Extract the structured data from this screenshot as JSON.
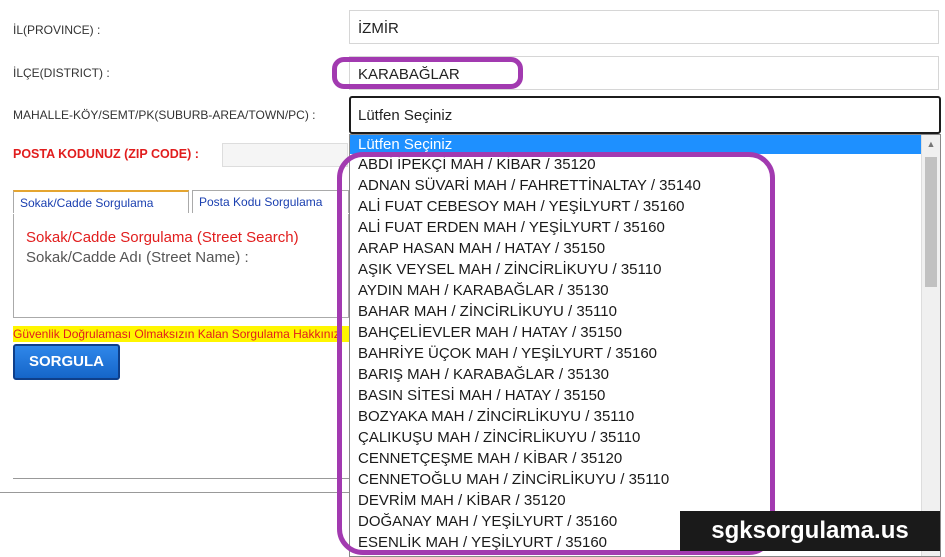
{
  "form": {
    "province_label": "İL(PROVINCE) :",
    "province_value": "İZMİR",
    "district_label": "İLÇE(DISTRICT) :",
    "district_value": "KARABAĞLAR",
    "suburb_label": "MAHALLE-KÖY/SEMT/PK(SUBURB-AREA/TOWN/PC) :",
    "suburb_selected": "Lütfen Seçiniz",
    "zip_label": "POSTA KODUNUZ (ZIP CODE) :"
  },
  "tabs": [
    {
      "label": "Sokak/Cadde Sorgulama"
    },
    {
      "label": "Posta Kodu Sorgulama"
    }
  ],
  "panel": {
    "title": "Sokak/Cadde Sorgulama (Street Search)",
    "street_label": "Sokak/Cadde Adı (Street Name) :"
  },
  "warning": "Güvenlik Doğrulaması Olmaksızın Kalan Sorgulama Hakkınız",
  "button": {
    "label": "SORGULA"
  },
  "dropdown": {
    "options": [
      "Lütfen Seçiniz",
      "ABDİ İPEKÇİ MAH / KİBAR / 35120",
      "ADNAN SÜVARİ MAH / FAHRETTİNALTAY / 35140",
      "ALİ FUAT CEBESOY MAH / YEŞİLYURT / 35160",
      "ALİ FUAT ERDEN MAH / YEŞİLYURT / 35160",
      "ARAP HASAN MAH / HATAY / 35150",
      "AŞIK VEYSEL MAH / ZİNCİRLİKUYU / 35110",
      "AYDIN MAH / KARABAĞLAR / 35130",
      "BAHAR MAH / ZİNCİRLİKUYU / 35110",
      "BAHÇELİEVLER MAH / HATAY / 35150",
      "BAHRİYE ÜÇOK MAH / YEŞİLYURT / 35160",
      "BARIŞ MAH / KARABAĞLAR / 35130",
      "BASIN SİTESİ MAH / HATAY / 35150",
      "BOZYAKA MAH / ZİNCİRLİKUYU / 35110",
      "ÇALIKUŞU MAH / ZİNCİRLİKUYU / 35110",
      "CENNETÇEŞME MAH / KİBAR / 35120",
      "CENNETOĞLU MAH / ZİNCİRLİKUYU / 35110",
      "DEVRİM MAH / KİBAR / 35120",
      "DOĞANAY MAH / YEŞİLYURT / 35160",
      "ESENLİK MAH / YEŞİLYURT / 35160"
    ]
  },
  "watermark": "sgksorgulama.us",
  "colors": {
    "highlight": "#a23ab0",
    "selected_option": "#1e90ff",
    "required_label": "#e11d1d"
  }
}
